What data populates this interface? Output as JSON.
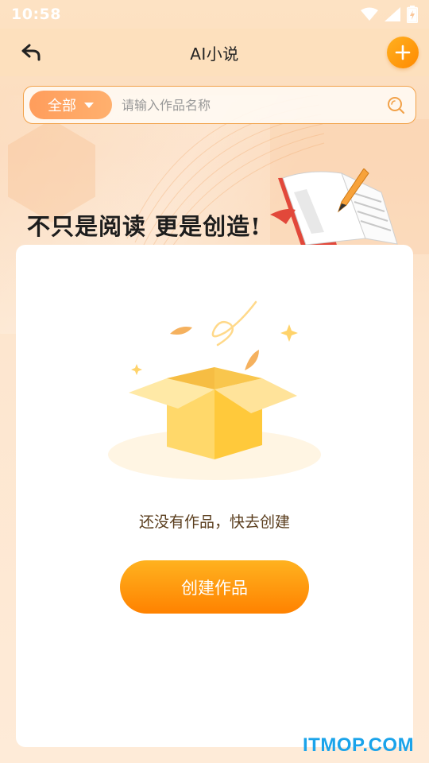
{
  "status_bar": {
    "time": "10:58",
    "icons": [
      "wifi-icon",
      "signal-icon",
      "battery-charging-icon"
    ]
  },
  "header": {
    "title": "AI小说",
    "back_icon": "back-arrow-icon",
    "add_icon": "plus-icon"
  },
  "search": {
    "filter_label": "全部",
    "placeholder": "请输入作品名称",
    "value": ""
  },
  "banner": {
    "slogan": "不只是阅读 更是创造!"
  },
  "empty_state": {
    "message": "还没有作品，快去创建",
    "button_label": "创建作品"
  },
  "watermark": {
    "text": "ITMOP.COM"
  },
  "colors": {
    "accent": "#ff8a00",
    "pill": "#ff9d5c",
    "background": "#fde2c3",
    "text_brown": "#5a3d1d"
  }
}
